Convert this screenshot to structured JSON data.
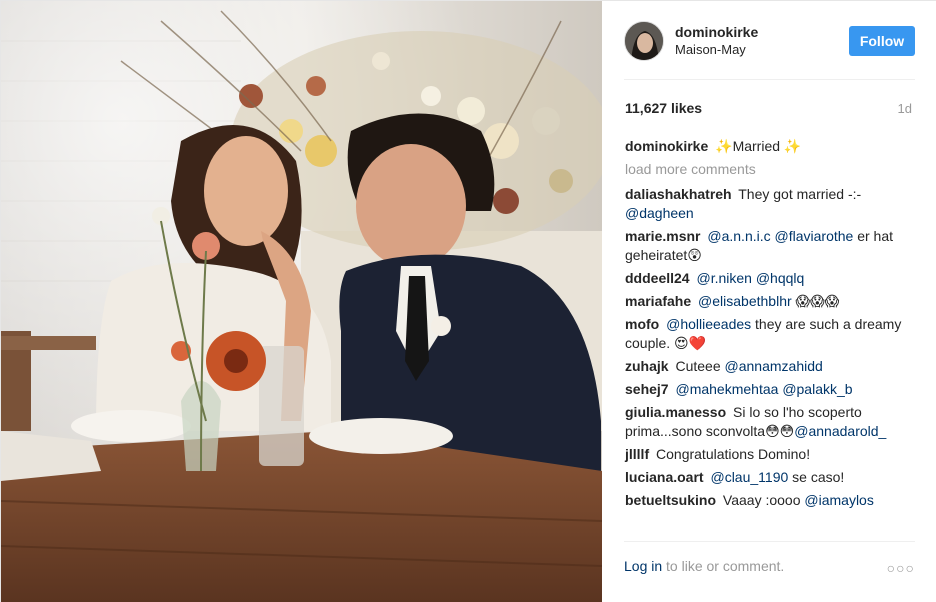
{
  "post": {
    "image_alt": "Couple sitting at a wooden table with flowers",
    "header": {
      "username": "dominokirke",
      "location": "Maison-May",
      "follow_label": "Follow"
    },
    "likes": "11,627 likes",
    "time_ago": "1d",
    "caption": {
      "username": "dominokirke",
      "text": "✨Married ✨"
    },
    "load_more": "load more comments",
    "comments": [
      {
        "username": "daliashakhatreh",
        "parts": [
          {
            "t": "They got married -:- "
          },
          {
            "t": "@dagheen",
            "mention": true
          }
        ]
      },
      {
        "username": "marie.msnr",
        "parts": [
          {
            "t": "@a.n.n.i.c",
            "mention": true
          },
          {
            "t": " "
          },
          {
            "t": "@flaviarothe",
            "mention": true
          },
          {
            "t": " er hat geheiratet😲"
          }
        ]
      },
      {
        "username": "dddeell24",
        "parts": [
          {
            "t": "@r.niken",
            "mention": true
          },
          {
            "t": " "
          },
          {
            "t": "@hqqlq",
            "mention": true
          }
        ]
      },
      {
        "username": "mariafahe",
        "parts": [
          {
            "t": "@elisabethblhr",
            "mention": true
          },
          {
            "t": " 😱😱😱"
          }
        ]
      },
      {
        "username": "mofo",
        "parts": [
          {
            "t": "@hollieeades",
            "mention": true
          },
          {
            "t": " they are such a dreamy couple. 😍❤️"
          }
        ]
      },
      {
        "username": "zuhajk",
        "parts": [
          {
            "t": "Cuteee "
          },
          {
            "t": "@annamzahidd",
            "mention": true
          }
        ]
      },
      {
        "username": "sehej7",
        "parts": [
          {
            "t": "@mahekmehtaa",
            "mention": true
          },
          {
            "t": " "
          },
          {
            "t": "@palakk_b",
            "mention": true
          }
        ]
      },
      {
        "username": "giulia.manesso",
        "parts": [
          {
            "t": "Si lo so l'ho scoperto prima...sono sconvolta😳😳"
          },
          {
            "t": "@annadarold_",
            "mention": true
          }
        ]
      },
      {
        "username": "jllllf",
        "parts": [
          {
            "t": "Congratulations Domino!"
          }
        ]
      },
      {
        "username": "luciana.oart",
        "parts": [
          {
            "t": "@clau_1190",
            "mention": true
          },
          {
            "t": " se caso!"
          }
        ]
      },
      {
        "username": "betueltsukino",
        "parts": [
          {
            "t": "Vaaay :oooo "
          },
          {
            "t": "@iamaylos",
            "mention": true
          }
        ]
      }
    ],
    "footer": {
      "login_label": "Log in",
      "login_tail": " to like or comment.",
      "more_icon": "more-options-icon"
    }
  },
  "colors": {
    "follow": "#3897f0",
    "mention": "#003569",
    "muted": "#999999"
  }
}
